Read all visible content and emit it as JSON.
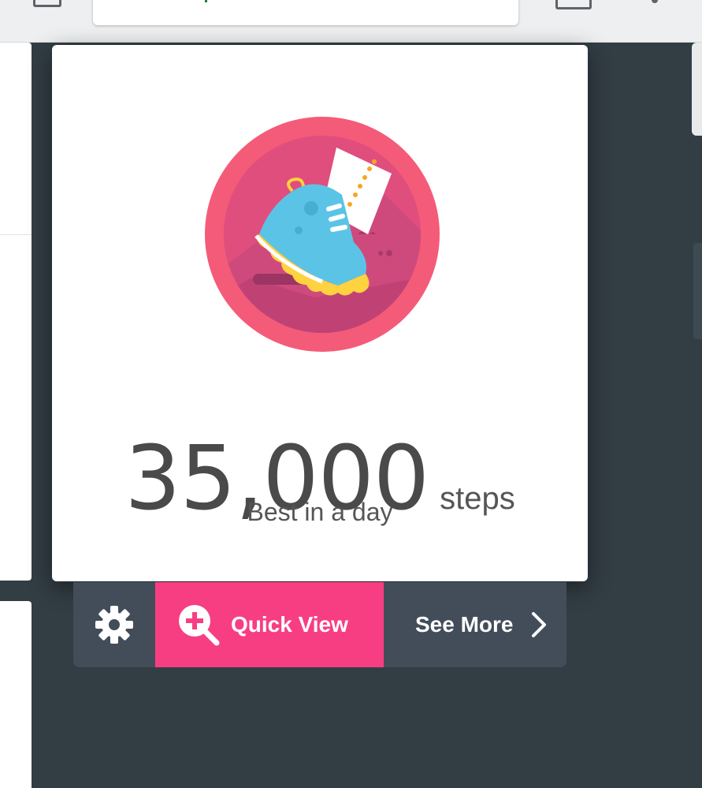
{
  "achievement": {
    "value": "35,000",
    "unit": "steps",
    "subtitle": "Best in a day"
  },
  "actions": {
    "quick_view_label": "Quick View",
    "see_more_label": "See More"
  },
  "colors": {
    "accent_pink": "#f73e83",
    "action_bar": "#434d5a",
    "background": "#323d44",
    "badge_ring": "#f45b78",
    "badge_inner": "#c74579"
  },
  "icons": [
    "gear-icon",
    "zoom-plus-icon",
    "chevron-right-icon",
    "sneaker-badge-icon"
  ]
}
